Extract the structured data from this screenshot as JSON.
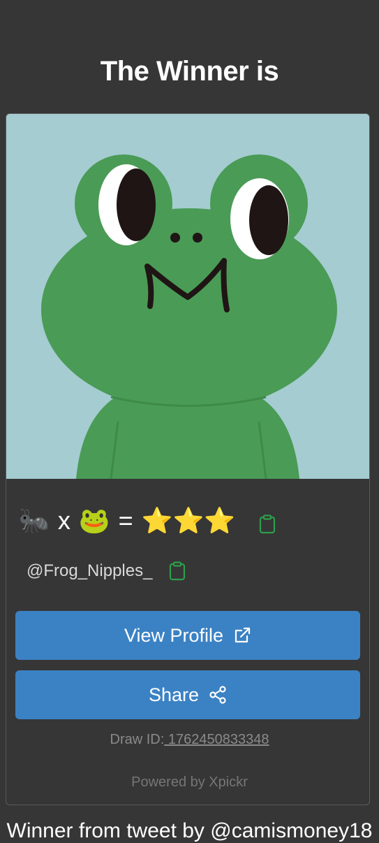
{
  "header": {
    "title": "The Winner is"
  },
  "winner": {
    "display_name": {
      "ant": "🐜",
      "x": "x",
      "frog": "🐸",
      "eq": "=",
      "stars": "⭐⭐⭐"
    },
    "handle": "@Frog_Nipples_"
  },
  "buttons": {
    "view_profile": "View Profile",
    "share": "Share"
  },
  "draw": {
    "label": "Draw ID:",
    "id": " 1762450833348"
  },
  "powered_by": "Powered by Xpickr",
  "footer": "Winner from tweet by @camismoney18",
  "colors": {
    "accent": "#3b82c4",
    "copy_icon": "#2e9e4a",
    "background": "#363636",
    "avatar_bg": "#a4ccd1",
    "frog_green": "#4a9b56"
  },
  "icons": [
    "clipboard-icon",
    "external-link-icon",
    "share-icon"
  ]
}
